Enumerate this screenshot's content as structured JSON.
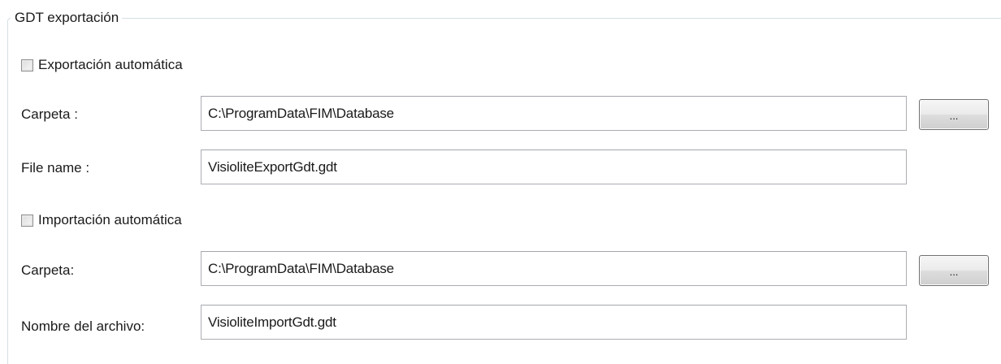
{
  "group": {
    "title": "GDT exportación"
  },
  "export": {
    "auto_label": "Exportación automática",
    "auto_checked": false,
    "folder_label": "Carpeta :",
    "folder_value": "C:\\ProgramData\\FIM\\Database",
    "browse_label": "...",
    "filename_label": "File name :",
    "filename_value": "VisioliteExportGdt.gdt"
  },
  "import": {
    "auto_label": "Importación automática",
    "auto_checked": false,
    "folder_label": "Carpeta:",
    "folder_value": "C:\\ProgramData\\FIM\\Database",
    "browse_label": "...",
    "filename_label": "Nombre del archivo:",
    "filename_value": "VisioliteImportGdt.gdt"
  }
}
